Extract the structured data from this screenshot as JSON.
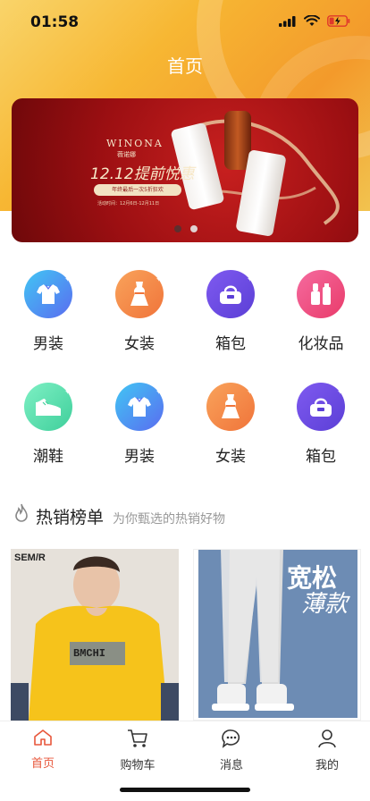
{
  "status": {
    "time": "01:58"
  },
  "nav": {
    "title": "首页"
  },
  "banner": {
    "brand": "WINONA",
    "brand_sub": "薇诺娜",
    "headline": "12.12提前悦惠",
    "pill_text": "年终最后一次5折狂欢",
    "small_text": "活动时间：12月6日-12月11日",
    "page_count": 2,
    "active_page": 1
  },
  "categories": [
    {
      "label": "男装",
      "icon": "shirt-icon",
      "color_from": "#41c6f4",
      "color_to": "#5a6cf0"
    },
    {
      "label": "女装",
      "icon": "dress-icon",
      "color_from": "#f9a35b",
      "color_to": "#f0743a"
    },
    {
      "label": "箱包",
      "icon": "bag-icon",
      "color_from": "#7f5af0",
      "color_to": "#5b3fd6"
    },
    {
      "label": "化妆品",
      "icon": "cosmetics-icon",
      "color_from": "#f56b9f",
      "color_to": "#e93b6a"
    },
    {
      "label": "潮鞋",
      "icon": "sneaker-icon",
      "color_from": "#7ef0c4",
      "color_to": "#3fcf9b"
    },
    {
      "label": "男装",
      "icon": "shirt-icon",
      "color_from": "#41c6f4",
      "color_to": "#5a6cf0"
    },
    {
      "label": "女装",
      "icon": "dress-icon",
      "color_from": "#f9a35b",
      "color_to": "#f0743a"
    },
    {
      "label": "箱包",
      "icon": "bag-icon",
      "color_from": "#7f5af0",
      "color_to": "#5b3fd6"
    }
  ],
  "hot": {
    "title": "热销榜单",
    "subtitle": "为你甄选的热销好物"
  },
  "products": [
    {
      "tag": "SEM/R",
      "print": "BMCHI"
    },
    {
      "headline": "宽松",
      "subhead": "薄款"
    }
  ],
  "tabbar": {
    "items": [
      {
        "label": "首页",
        "icon": "home-icon",
        "active": true
      },
      {
        "label": "购物车",
        "icon": "cart-icon",
        "active": false
      },
      {
        "label": "消息",
        "icon": "message-icon",
        "active": false
      },
      {
        "label": "我的",
        "icon": "user-icon",
        "active": false
      }
    ]
  },
  "colors": {
    "accent": "#e8573b",
    "hero": "#f7b733"
  }
}
